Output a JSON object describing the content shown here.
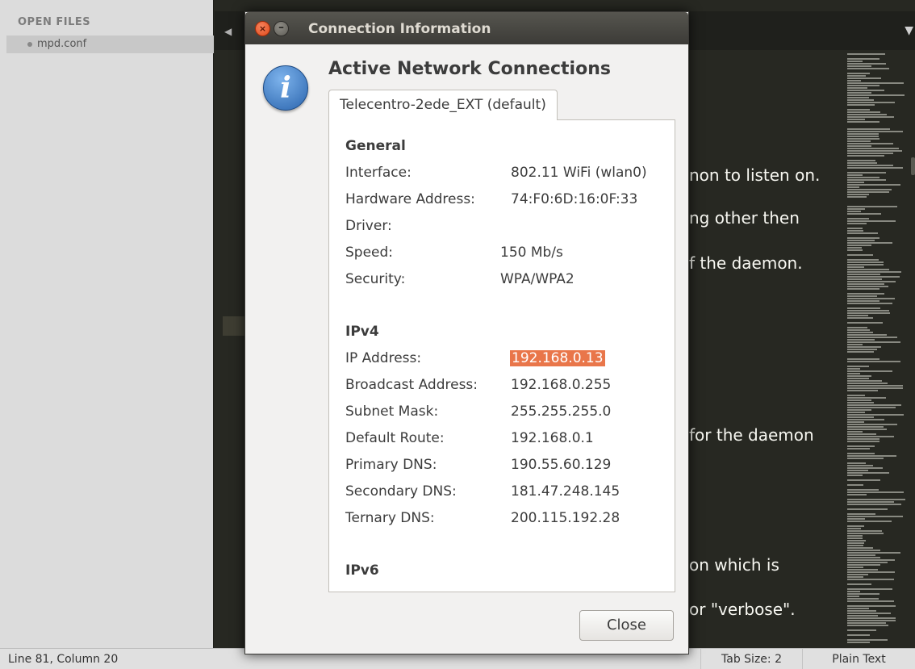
{
  "sidebar": {
    "header": "OPEN FILES",
    "open_files": [
      {
        "name": "mpd.conf"
      }
    ]
  },
  "editor": {
    "visible_text": [
      "non to listen on.",
      "ng other then",
      "f the daemon.",
      "for the daemon",
      "on which is",
      "or \"verbose\"."
    ]
  },
  "statusbar": {
    "position": "Line 81, Column 20",
    "tab_size": "Tab Size: 2",
    "syntax": "Plain Text"
  },
  "dialog": {
    "title": "Connection Information",
    "heading": "Active Network Connections",
    "tab": "Telecentro-2ede_EXT (default)",
    "general": {
      "title": "General",
      "rows": [
        {
          "label": "Interface:",
          "value": "802.11 WiFi (wlan0)"
        },
        {
          "label": "Hardware Address:",
          "value": "74:F0:6D:16:0F:33"
        },
        {
          "label": "Driver:",
          "value": ""
        },
        {
          "label": "Speed:",
          "value": "150 Mb/s"
        },
        {
          "label": "Security:",
          "value": "WPA/WPA2"
        }
      ]
    },
    "ipv4": {
      "title": "IPv4",
      "rows": [
        {
          "label": "IP Address:",
          "value": "192.168.0.13"
        },
        {
          "label": "Broadcast Address:",
          "value": "192.168.0.255"
        },
        {
          "label": "Subnet Mask:",
          "value": "255.255.255.0"
        },
        {
          "label": "Default Route:",
          "value": "192.168.0.1"
        },
        {
          "label": "Primary DNS:",
          "value": "190.55.60.129"
        },
        {
          "label": "Secondary DNS:",
          "value": "181.47.248.145"
        },
        {
          "label": "Ternary DNS:",
          "value": "200.115.192.28"
        }
      ]
    },
    "ipv6": {
      "title": "IPv6"
    },
    "close_label": "Close"
  },
  "colors": {
    "editor_bg": "#272822",
    "selection": "#e9764a",
    "info_icon": "#3d7ac8"
  },
  "icons": [
    "window-close-icon",
    "window-minimize-icon",
    "info-icon",
    "tab-scroll-left-icon",
    "tab-dropdown-icon"
  ]
}
